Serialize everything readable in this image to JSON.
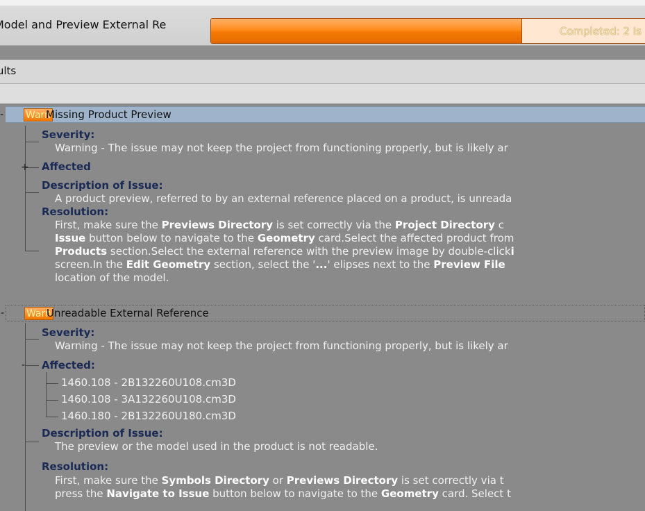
{
  "window": {
    "title": "Model and Preview External Re",
    "progress_text": "Completed: 2 Is",
    "progress_fraction": 0.7
  },
  "results": {
    "label": "sults"
  },
  "issues": [
    {
      "badge": "Warn",
      "title": "Missing Product Preview",
      "severity_label": "Severity:",
      "severity_text": "Warning - The issue may not keep the project from functioning properly, but is likely ar",
      "affected_label": "Affected",
      "description_label": "Description of Issue:",
      "description_text": "A product preview, referred to by an external reference placed on a product, is unreada",
      "resolution_label": "Resolution:",
      "resolution_lines": [
        {
          "a": "First, make sure the ",
          "b1": "Previews Directory",
          "c": " is set correctly via the ",
          "b2": "Project Directory",
          "d": " c"
        },
        {
          "b1": "Issue",
          "a": " button below to navigate to the ",
          "b2": "Geometry",
          "c": " card.Select the affected product from"
        },
        {
          "b1": "Products",
          "a": " section.Select the external reference with the preview image by double-click",
          "b2": "i"
        },
        {
          "a": "screen.In the ",
          "b1": "Edit Geometry",
          "c": " section, select the '",
          "b2": "...",
          "d": "' elipses next to the ",
          "b3": "Preview File"
        },
        {
          "a": "location of the model."
        }
      ]
    },
    {
      "badge": "Warn",
      "title": "Unreadable External Reference",
      "severity_label": "Severity:",
      "severity_text": "Warning - The issue may not keep the project from functioning properly, but is likely ar",
      "affected_label": "Affected:",
      "affected_items": [
        "1460.108 - 2B132260U108.cm3D",
        "1460.108 - 3A132260U108.cm3D",
        "1460.180 - 2B132260U180.cm3D"
      ],
      "description_label": "Description of Issue:",
      "description_text": "The preview or the model used in the product is not readable.",
      "resolution_label": "Resolution:",
      "resolution_lines": [
        {
          "a": "First, make sure the ",
          "b1": "Symbols Directory",
          "c": " or ",
          "b2": "Previews Directory",
          "d": " is set correctly via t"
        },
        {
          "a": "press the ",
          "b1": "Navigate to Issue",
          "c": " button below to navigate to the ",
          "b2": "Geometry",
          "d": " card. Select t"
        }
      ]
    }
  ],
  "icons": {
    "collapse": "minus-icon",
    "expand": "plus-icon"
  }
}
